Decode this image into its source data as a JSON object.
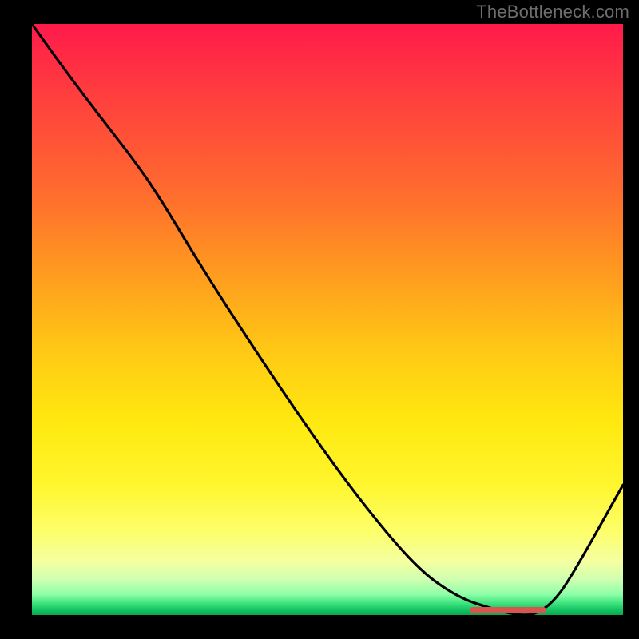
{
  "attribution": "TheBottleneck.com",
  "chart_data": {
    "type": "line",
    "title": "",
    "xlabel": "",
    "ylabel": "",
    "xlim": [
      0,
      100
    ],
    "ylim": [
      0,
      100
    ],
    "grid": false,
    "background_gradient": "red-to-green vertical (bottleneck severity, red=high, green=optimal)",
    "series": [
      {
        "name": "bottleneck-curve",
        "x": [
          0,
          5,
          11,
          18,
          22,
          28,
          35,
          45,
          55,
          65,
          72,
          78,
          82,
          85,
          88,
          91,
          100
        ],
        "values": [
          100,
          93,
          85,
          76,
          70,
          60,
          49,
          34,
          20,
          8,
          3,
          1,
          0,
          0,
          2,
          6,
          22
        ]
      }
    ],
    "optimal_range": {
      "x_start": 74,
      "x_end": 87,
      "y": 0.8
    }
  },
  "colors": {
    "curve": "#000000",
    "marker": "#d9534f",
    "attribution_text": "#6e6e6e"
  }
}
